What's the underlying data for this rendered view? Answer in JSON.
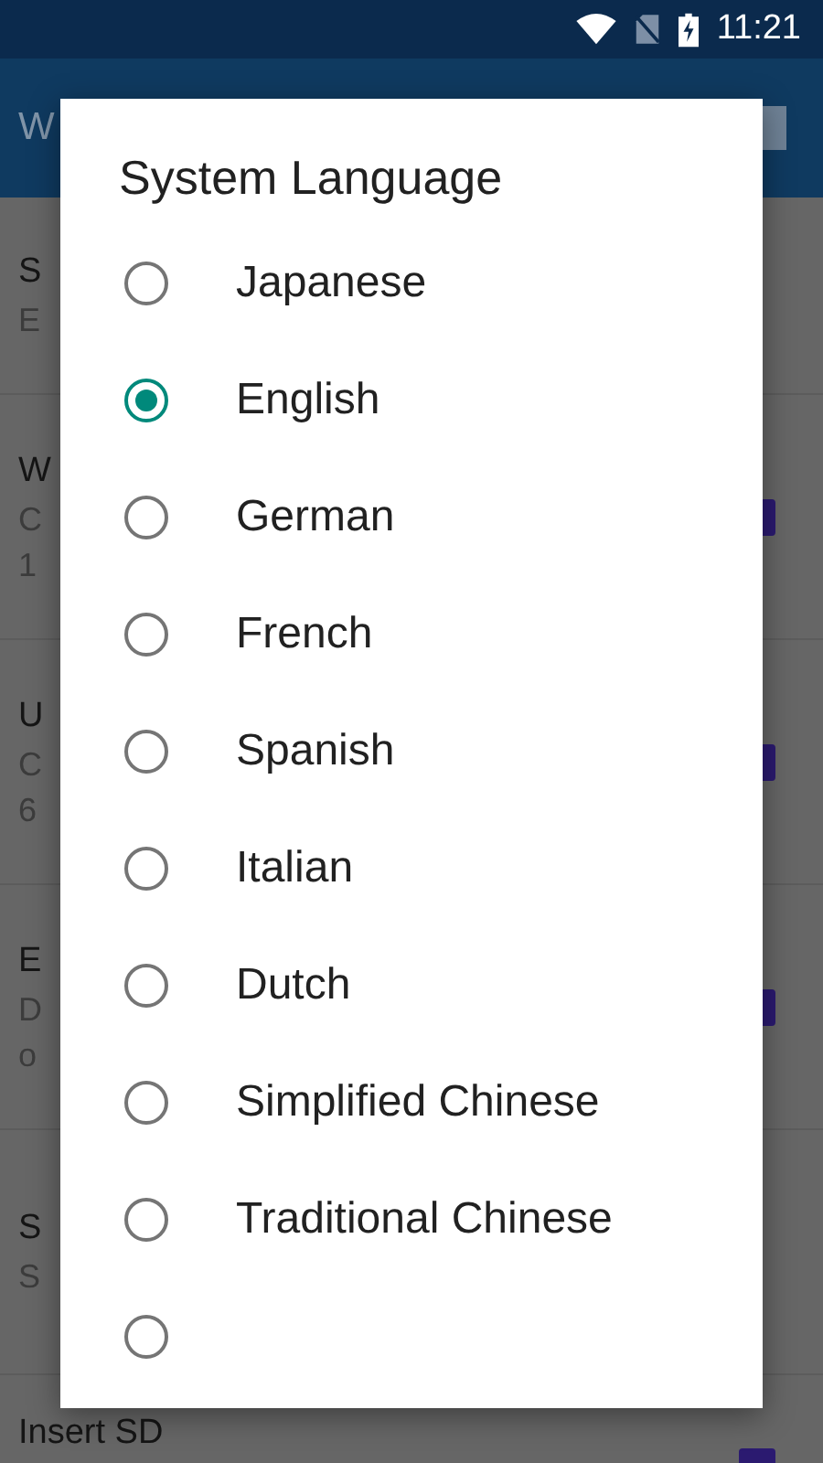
{
  "status_bar": {
    "time": "11:21"
  },
  "app_bar": {
    "title": "W"
  },
  "settings": [
    {
      "kind": "plain",
      "title": "S",
      "lines": [
        "E"
      ]
    },
    {
      "kind": "checkbox",
      "title": "W",
      "lines": [
        "C",
        "1"
      ],
      "checked": true
    },
    {
      "kind": "checkbox",
      "title": "U",
      "lines": [
        "C",
        "6"
      ],
      "checked": true
    },
    {
      "kind": "checkbox",
      "title": "E",
      "lines": [
        "D",
        "o"
      ],
      "checked": true
    },
    {
      "kind": "plain",
      "title": "S",
      "lines": [
        "S"
      ]
    },
    {
      "kind": "checkbox",
      "title": "Insert SD",
      "checked": true
    }
  ],
  "dialog": {
    "title": "System Language",
    "options": [
      {
        "label": "Japanese",
        "selected": false
      },
      {
        "label": "English",
        "selected": true
      },
      {
        "label": "German",
        "selected": false
      },
      {
        "label": "French",
        "selected": false
      },
      {
        "label": "Spanish",
        "selected": false
      },
      {
        "label": "Italian",
        "selected": false
      },
      {
        "label": "Dutch",
        "selected": false
      },
      {
        "label": "Simplified Chinese",
        "selected": false
      },
      {
        "label": "Traditional Chinese",
        "selected": false
      },
      {
        "selected": false
      }
    ]
  }
}
